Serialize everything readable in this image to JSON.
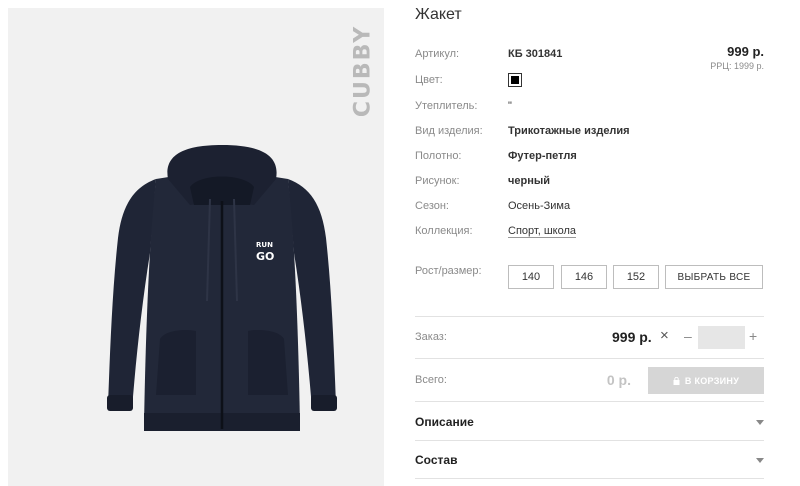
{
  "product": {
    "title": "Жакет",
    "brand": "CUBBY",
    "print_text": [
      "RUN",
      "GO"
    ],
    "price": "999 р.",
    "rrp": "РРЦ: 1999 р."
  },
  "attributes": [
    {
      "label": "Артикул:",
      "value": "КБ 301841",
      "style": "bold"
    },
    {
      "label": "Цвет:",
      "value": "",
      "style": "swatch",
      "swatch_color": "#000000"
    },
    {
      "label": "Утеплитель:",
      "value": "\"",
      "style": "normal"
    },
    {
      "label": "Вид изделия:",
      "value": "Трикотажные изделия",
      "style": "bold"
    },
    {
      "label": "Полотно:",
      "value": "Футер-петля",
      "style": "bold"
    },
    {
      "label": "Рисунок:",
      "value": "черный",
      "style": "bold"
    },
    {
      "label": "Сезон:",
      "value": "Осень-Зима",
      "style": "normal"
    },
    {
      "label": "Коллекция:",
      "value": "Спорт, школа",
      "style": "link"
    }
  ],
  "sizes": {
    "label": "Рост/размер:",
    "options": [
      "140",
      "146",
      "152"
    ],
    "select_all": "ВЫБРАТЬ ВСЕ"
  },
  "order": {
    "label": "Заказ:",
    "price": "999 р.",
    "times": "×",
    "minus": "–",
    "plus": "+",
    "quantity": ""
  },
  "total": {
    "label": "Всего:",
    "value": "0 р.",
    "cart_button": "В КОРЗИНУ"
  },
  "sections": [
    {
      "label": "Описание"
    },
    {
      "label": "Состав"
    }
  ],
  "colors": {
    "photo_bg": "#f1f1f1",
    "jacket": "#1c2233",
    "cart_button_disabled": "#d6d6d6"
  }
}
